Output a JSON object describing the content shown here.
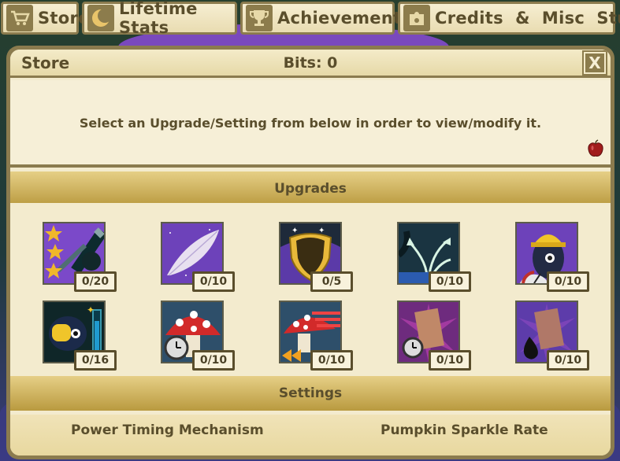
{
  "tabs": [
    {
      "label": "Store",
      "icon": "cart-icon"
    },
    {
      "label": "Lifetime Stats",
      "icon": "moon-icon"
    },
    {
      "label": "Achievements",
      "icon": "trophy-icon"
    },
    {
      "label": "Credits  &  Misc  Stuff",
      "icon": "puzzle-icon"
    }
  ],
  "panel": {
    "title": "Store",
    "bits": "Bits: 0",
    "close": "X",
    "description": "Select an Upgrade/Setting from below in order to view/modify it."
  },
  "sections": {
    "upgrades": "Upgrades",
    "settings": "Settings"
  },
  "upgrades": [
    {
      "count": "0/20",
      "icon": "stars-telescope-icon"
    },
    {
      "count": "0/10",
      "icon": "feather-icon"
    },
    {
      "count": "0/5",
      "icon": "shield-icon"
    },
    {
      "count": "0/10",
      "icon": "branching-arrows-icon"
    },
    {
      "count": "0/10",
      "icon": "hardhat-gauge-icon"
    },
    {
      "count": "0/16",
      "icon": "power-meter-icon"
    },
    {
      "count": "0/10",
      "icon": "mushroom-clock-icon"
    },
    {
      "count": "0/10",
      "icon": "mushroom-speed-icon"
    },
    {
      "count": "0/10",
      "icon": "card-clock-icon"
    },
    {
      "count": "0/10",
      "icon": "card-oil-icon"
    }
  ],
  "settings": [
    {
      "label": "Power Timing Mechanism"
    },
    {
      "label": "Pumpkin Sparkle Rate"
    }
  ],
  "colors": {
    "frame": "#8b7b4e",
    "panel_bg": "#f3ebce",
    "section_gold": "#d4b660",
    "text": "#5a4e2c"
  }
}
